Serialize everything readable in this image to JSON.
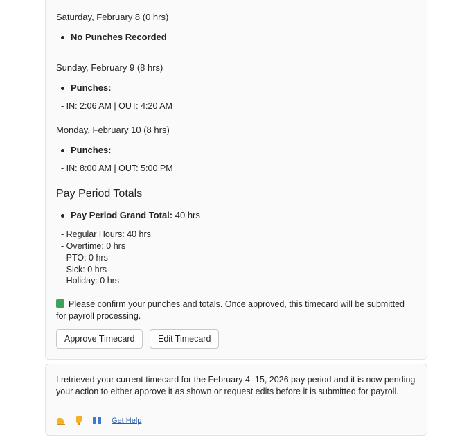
{
  "timecard": {
    "days": [
      {
        "heading": "Saturday, February 8 (0 hrs)",
        "bullet": "No Punches Recorded",
        "detail": ""
      },
      {
        "heading": "Sunday, February 9 (8 hrs)",
        "bullet": "Punches:",
        "detail": "- IN: 2:06 AM | OUT: 4:20 AM"
      },
      {
        "heading": "Monday, February 10 (8 hrs)",
        "bullet": "Punches:",
        "detail": "- IN: 8:00 AM | OUT: 5:00 PM"
      }
    ],
    "totals": {
      "title": "Pay Period Totals",
      "grand_total_label": "Pay Period Grand Total:",
      "grand_total_value": "40 hrs",
      "lines": [
        "- Regular Hours: 40 hrs",
        "- Overtime: 0 hrs",
        "- PTO: 0 hrs",
        "- Sick: 0 hrs",
        "- Holiday: 0 hrs"
      ]
    },
    "confirm_icon": "green-square-icon",
    "confirm_text": "Please confirm your punches and totals. Once approved, this timecard will be submitted for payroll processing.",
    "buttons": {
      "approve": "Approve Timecard",
      "edit": "Edit Timecard"
    }
  },
  "summary": {
    "text": "I retrieved your current timecard for the February 4–15, 2026 pay period and it is now pending your action to either approve it as shown or request edits before it is submitted for payroll.",
    "feedback_icons": [
      "thumbs-up-icon",
      "thumbs-down-icon",
      "copy-icon"
    ],
    "help_link": "Get Help"
  },
  "colors": {
    "card_bg": "#fafafa",
    "card_border": "#e3e3e3",
    "link": "#2a5db0",
    "confirm_icon": "#3fa25a"
  }
}
